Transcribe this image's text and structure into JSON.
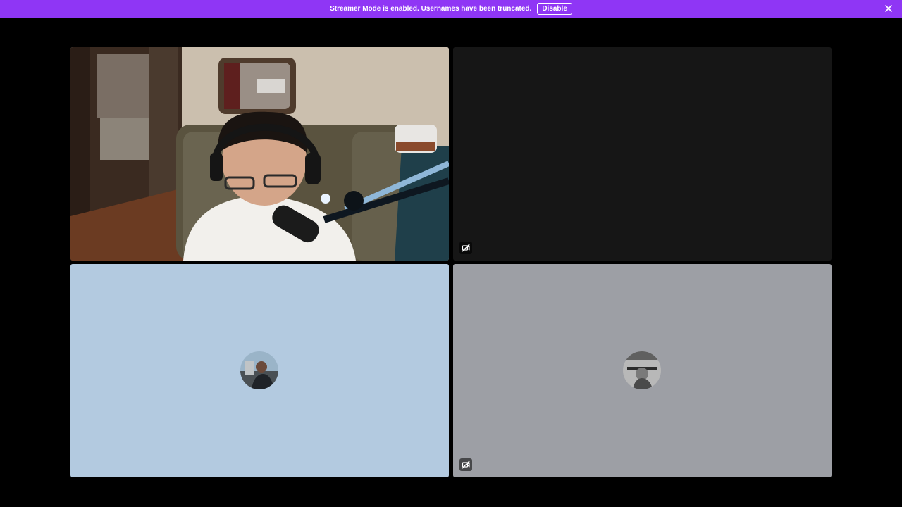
{
  "banner": {
    "message": "Streamer Mode is enabled. Usernames have been truncated.",
    "disable_label": "Disable",
    "close_icon": "close-icon",
    "color": "#8f36f5"
  },
  "tiles": [
    {
      "id": "tile-1",
      "kind": "camera-video",
      "background": "#2b241f"
    },
    {
      "id": "tile-2",
      "kind": "video-off",
      "background": "#161616",
      "badge_icon": "video-off-icon"
    },
    {
      "id": "tile-3",
      "kind": "avatar",
      "background": "#b3cae0"
    },
    {
      "id": "tile-4",
      "kind": "avatar",
      "background": "#9d9fa5",
      "badge_icon": "video-off-icon"
    }
  ]
}
